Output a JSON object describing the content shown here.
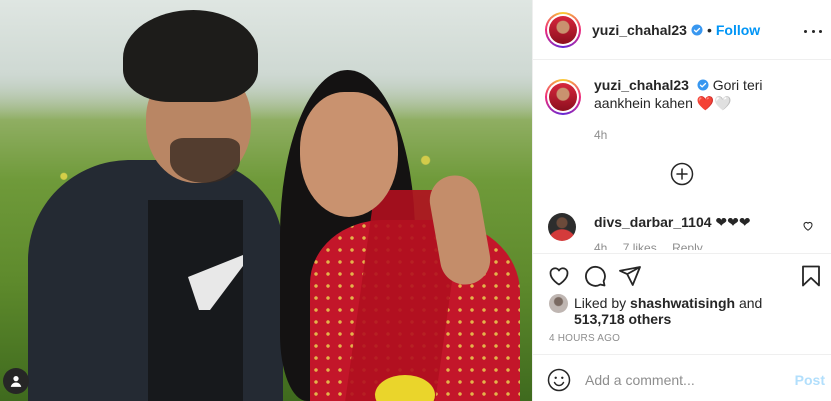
{
  "post": {
    "username": "yuzi_chahal23",
    "follow_label": "Follow",
    "caption": "Gori teri aankhein kahen ❤️🤍",
    "caption_time": "4h"
  },
  "comments": [
    {
      "username": "divs_darbar_1104",
      "text": "❤❤❤",
      "time": "4h",
      "likes": "7 likes",
      "reply_label": "Reply"
    }
  ],
  "likes": {
    "prefix": "Liked by",
    "user": "shashwatisingh",
    "and": "and",
    "count": "513,718 others"
  },
  "timestamp": "4 HOURS AGO",
  "add_comment": {
    "placeholder": "Add a comment...",
    "post_label": "Post"
  },
  "colors": {
    "accent": "#0095f6",
    "post_disabled": "#b2dffc",
    "muted": "#8e8e8e",
    "verified": "#3897f0"
  },
  "icons": [
    "more-options-icon",
    "verified-badge-icon",
    "load-more-comments-icon",
    "heart-icon",
    "comment-icon",
    "share-icon",
    "bookmark-icon",
    "emoji-icon",
    "user-tag-icon"
  ]
}
